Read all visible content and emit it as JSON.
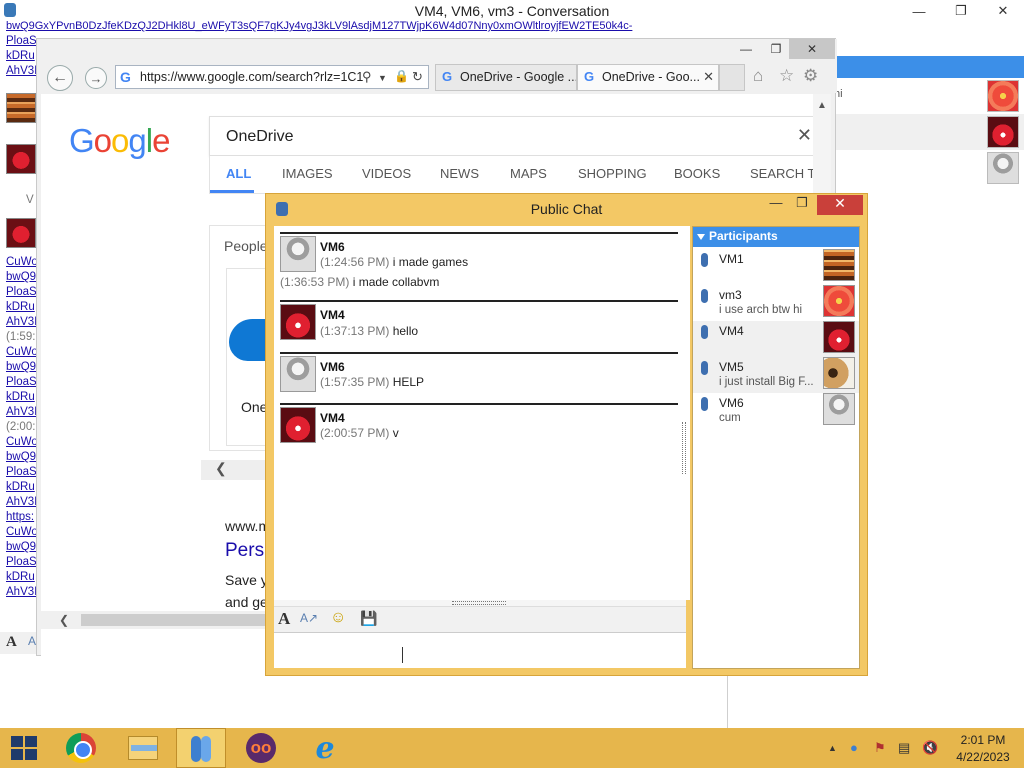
{
  "conversation": {
    "title": "VM4, VM6, vm3 - Conversation",
    "link_line": "bwQ9GxYPvnB0DzJfeKDzQJ2DHkl8U_eWFyT3sQF7qKJy4vgJ3kLV9lAsdjM127TWjpK6W4d07Nny0xmOWltlroyjfEW2TE50k4c-",
    "left_col_top": [
      "PloaS",
      "kDRu",
      "AhV3I"
    ],
    "left_col_mid": [
      "CuWo",
      "bwQ9",
      "PloaS",
      "kDRu",
      "AhV3I"
    ],
    "time1": "(1:59:",
    "left_col_mid2": [
      "CuWo",
      "bwQ9",
      "PloaS",
      "kDRu",
      "AhV3I"
    ],
    "time2": "(2:00:",
    "left_col_bottom": [
      "CuWo",
      "bwQ9",
      "PloaS",
      "kDRu",
      "AhV3I",
      "https:",
      "CuWo",
      "bwQ9",
      "PloaS",
      "kDRu",
      "AhV3I"
    ],
    "left_v": "V",
    "right_snippet": "hi"
  },
  "browser": {
    "url": "https://www.google.com/search?rlz=1C1",
    "tabs": [
      "OneDrive - Google ...",
      "OneDrive - Goo..."
    ],
    "search_query": "OneDrive",
    "google_tabs": [
      "ALL",
      "IMAGES",
      "VIDEOS",
      "NEWS",
      "MAPS",
      "SHOPPING",
      "BOOKS",
      "SEARCH T"
    ],
    "people_title": "People",
    "onedrive_label": "One",
    "result_url_frag": "www.m",
    "result_title": "Pers",
    "result_snip1": "Save y",
    "result_snip2": "and ge"
  },
  "public_chat": {
    "title": "Public Chat",
    "messages": [
      {
        "name": "VM6",
        "lines": [
          {
            "ts": "(1:24:56 PM)",
            "text": " i  made games"
          },
          {
            "ts": "(1:36:53 PM)",
            "text": " i made collabvm"
          }
        ]
      },
      {
        "name": "VM4",
        "lines": [
          {
            "ts": "(1:37:13 PM)",
            "text": " hello"
          }
        ]
      },
      {
        "name": "VM6",
        "lines": [
          {
            "ts": "(1:57:35 PM)",
            "text": " HELP"
          }
        ]
      },
      {
        "name": "VM4",
        "lines": [
          {
            "ts": "(2:00:57 PM)",
            "text": " v"
          }
        ]
      }
    ],
    "participants_label": "Participants",
    "participants": [
      {
        "name": "VM1",
        "status": ""
      },
      {
        "name": "vm3",
        "status": "i use arch btw hi"
      },
      {
        "name": "VM4",
        "status": ""
      },
      {
        "name": "VM5",
        "status": "i just install Big F..."
      },
      {
        "name": "VM6",
        "status": "cum"
      }
    ]
  },
  "taskbar": {
    "time": "2:01 PM",
    "date": "4/22/2023",
    "infinity_label": "oo"
  }
}
